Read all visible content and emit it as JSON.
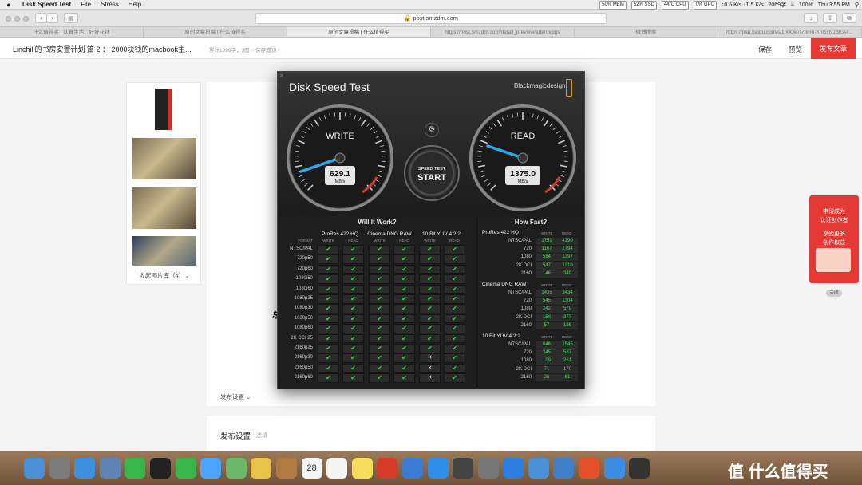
{
  "menubar": {
    "apple_icon": "apple-icon",
    "app_name": "Disk Speed Test",
    "menus": [
      "File",
      "Stress",
      "Help"
    ],
    "stats": [
      "50% MEM",
      "52% SSD",
      "44°C CPU",
      "0% GPU",
      "↑0.5 K/s ↓1.5 K/s"
    ],
    "word_count": "2069字",
    "battery": "100%",
    "clock": "Thu 3:55 PM"
  },
  "browser": {
    "url": "post.smzdm.com",
    "tabs": [
      "什么值得买 | 认真生活，好好花钱",
      "原创文章投稿 | 什么值得买",
      "原创文章投稿 | 什么值得买",
      "https://post.smzdm.com/detail_preview/adenpqqp/",
      "微博搜索",
      "https://pan.baidu.com/s/1n0Qe7f7pm6-XhGxNJBlcA#..."
    ],
    "active_tab": 2
  },
  "editor_header": {
    "title": "Linchill的书房安置计划 篇 2 ： 2000块钱的macbook主...",
    "meta": "累计1099字，3图   ○ 保存成功",
    "save": "保存",
    "preview": "预览",
    "publish": "发布文章"
  },
  "sidebar": {
    "collapse_label": "收起图片库（4）⌄"
  },
  "editor": {
    "left_char": "总",
    "publish_settings_toggle": "发布设置 ⌄"
  },
  "publish_panel": {
    "heading": "发布设置",
    "optional": "选填"
  },
  "promo": {
    "line1": "申请成为",
    "line2": "认证创作者",
    "line3": "享受更多",
    "line4": "创作权益",
    "close": "关闭"
  },
  "dst": {
    "title": "Disk Speed Test",
    "brand": "Blackmagicdesign",
    "gear_icon": "gear-icon",
    "start_top": "SPEED TEST",
    "start_label": "START",
    "write": {
      "label": "WRITE",
      "value": "629.1",
      "unit": "MB/s"
    },
    "read": {
      "label": "READ",
      "value": "1375.0",
      "unit": "MB/s"
    },
    "will": {
      "title": "Will It Work?",
      "format_label": "FORMAT",
      "groups": [
        "ProRes 422 HQ",
        "Cinema DNG RAW",
        "10 Bit YUV 4:2:2"
      ],
      "sub": [
        "WRITE",
        "READ"
      ],
      "rows": [
        {
          "fmt": "NTSC/PAL",
          "v": [
            1,
            1,
            1,
            1,
            1,
            1
          ]
        },
        {
          "fmt": "720p50",
          "v": [
            1,
            1,
            1,
            1,
            1,
            1
          ]
        },
        {
          "fmt": "720p60",
          "v": [
            1,
            1,
            1,
            1,
            1,
            1
          ]
        },
        {
          "fmt": "1080i50",
          "v": [
            1,
            1,
            1,
            1,
            1,
            1
          ]
        },
        {
          "fmt": "1080i60",
          "v": [
            1,
            1,
            1,
            1,
            1,
            1
          ]
        },
        {
          "fmt": "1080p25",
          "v": [
            1,
            1,
            1,
            1,
            1,
            1
          ]
        },
        {
          "fmt": "1080p30",
          "v": [
            1,
            1,
            1,
            1,
            1,
            1
          ]
        },
        {
          "fmt": "1080p50",
          "v": [
            1,
            1,
            1,
            1,
            1,
            1
          ]
        },
        {
          "fmt": "1080p60",
          "v": [
            1,
            1,
            1,
            1,
            1,
            1
          ]
        },
        {
          "fmt": "2K DCI 25",
          "v": [
            1,
            1,
            1,
            1,
            1,
            1
          ]
        },
        {
          "fmt": "2160p25",
          "v": [
            1,
            1,
            1,
            1,
            1,
            1
          ]
        },
        {
          "fmt": "2160p30",
          "v": [
            1,
            1,
            1,
            1,
            0,
            1
          ]
        },
        {
          "fmt": "2160p50",
          "v": [
            1,
            1,
            1,
            1,
            0,
            1
          ]
        },
        {
          "fmt": "2160p60",
          "v": [
            1,
            1,
            1,
            1,
            0,
            1
          ]
        }
      ]
    },
    "how": {
      "title": "How Fast?",
      "sub": [
        "WRITE",
        "READ"
      ],
      "groups": [
        {
          "name": "ProRes 422 HQ",
          "rows": [
            [
              "NTSC/PAL",
              "1751",
              "4190"
            ],
            [
              "720",
              "1167",
              "2794"
            ],
            [
              "1080",
              "584",
              "1397"
            ],
            [
              "2K DCI",
              "547",
              "1310"
            ],
            [
              "2160",
              "146",
              "349"
            ]
          ]
        },
        {
          "name": "Cinema DNG RAW",
          "rows": [
            [
              "NTSC/PAL",
              "1435",
              "3434"
            ],
            [
              "720",
              "545",
              "1304"
            ],
            [
              "1080",
              "242",
              "579"
            ],
            [
              "2K DCI",
              "158",
              "377"
            ],
            [
              "2160",
              "57",
              "136"
            ]
          ]
        },
        {
          "name": "10 Bit YUV 4:2:2",
          "rows": [
            [
              "NTSC/PAL",
              "646",
              "1545"
            ],
            [
              "720",
              "245",
              "587"
            ],
            [
              "1080",
              "109",
              "261"
            ],
            [
              "2K DCI",
              "71",
              "170"
            ],
            [
              "2160",
              "26",
              "61"
            ]
          ]
        }
      ]
    }
  },
  "dock": {
    "apps": [
      "finder",
      "launchpad",
      "safari",
      "preview",
      "facetime",
      "qq",
      "wechat",
      "messages",
      "maps",
      "photos",
      "contacts",
      "calendar",
      "reminders",
      "notes",
      "netease-music",
      "feishu",
      "app-store",
      "activity-monitor",
      "system-preferences",
      "teamviewer",
      "finder-2",
      "photos-2",
      "sohu",
      "baidu-netdisk",
      "dashboard"
    ],
    "calendar_date": "28",
    "watermark": "值 什么值得买"
  }
}
